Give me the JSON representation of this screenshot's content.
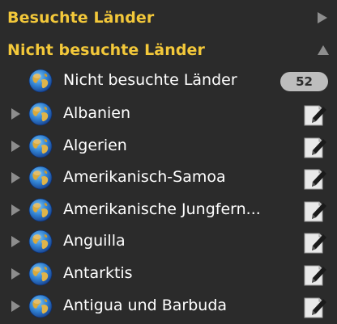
{
  "sections": {
    "visited": {
      "title": "Besuchte Länder",
      "expanded": false
    },
    "not_visited": {
      "title": "Nicht besuchte Länder",
      "expanded": true
    }
  },
  "summary_row": {
    "label": "Nicht besuchte Länder",
    "count": "52",
    "icon": "globe-icon"
  },
  "countries": [
    {
      "label": "Albanien"
    },
    {
      "label": "Algerien"
    },
    {
      "label": "Amerikanisch-Samoa"
    },
    {
      "label": "Amerikanische Jungfern..."
    },
    {
      "label": "Anguilla"
    },
    {
      "label": "Antarktis"
    },
    {
      "label": "Antigua und Barbuda"
    }
  ],
  "icons": {
    "row_icon": "globe-icon",
    "action_icon": "edit-note-icon",
    "disclosure_icon": "disclosure-triangle-icon"
  },
  "colors": {
    "background": "#2b2b2b",
    "section_title": "#f3c83a",
    "text": "#ffffff",
    "badge": "#bdbdbd"
  }
}
